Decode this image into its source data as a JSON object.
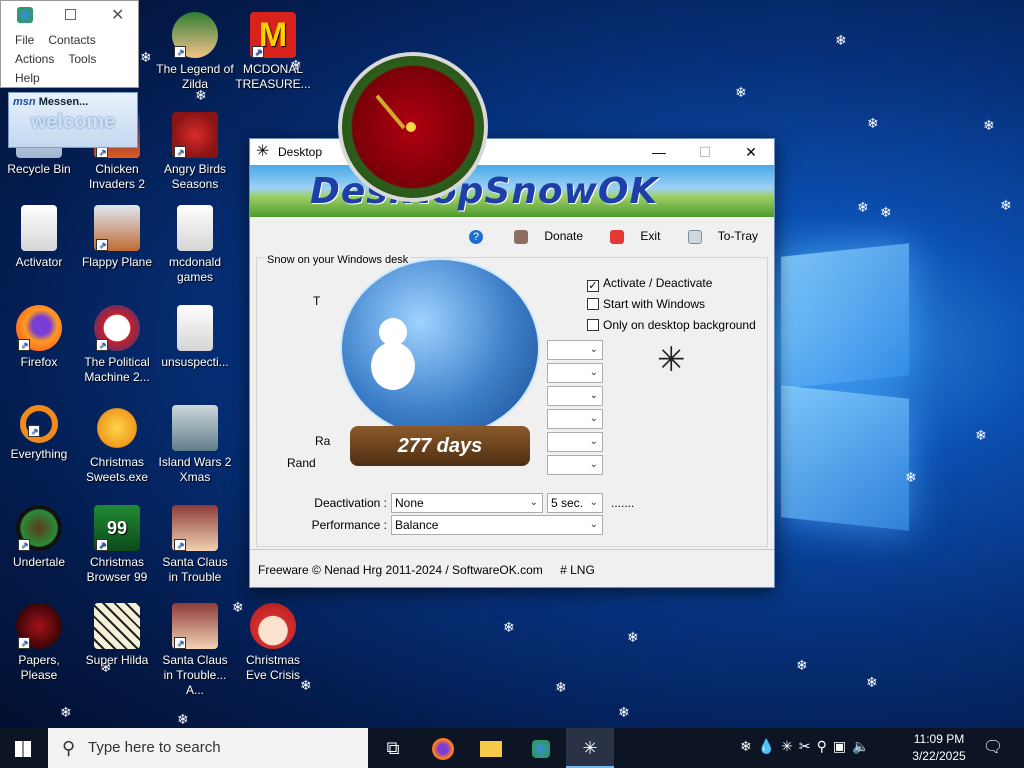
{
  "messenger": {
    "menu_row1": [
      "File",
      "Contacts"
    ],
    "menu_row2": [
      "Actions",
      "Tools"
    ],
    "menu_row3": [
      "Help"
    ],
    "msn_label": "Messen...",
    "welcome": "welcome",
    "logo_text": "msn"
  },
  "desktop_icons": [
    {
      "label": "Recycle Bin",
      "icon": "recycle-bin-icon"
    },
    {
      "label": "Activator",
      "icon": "folder-icon"
    },
    {
      "label": "Firefox",
      "icon": "firefox-icon"
    },
    {
      "label": "Everything",
      "icon": "everything-icon"
    },
    {
      "label": "Undertale",
      "icon": "undertale-icon"
    },
    {
      "label": "Papers, Please",
      "icon": "papers-please-icon"
    },
    {
      "label": "The Legend of Zilda",
      "icon": "game-icon"
    },
    {
      "label": "Chicken Invaders 2",
      "icon": "game-icon"
    },
    {
      "label": "Flappy Plane",
      "icon": "game-icon"
    },
    {
      "label": "The Political Machine 2...",
      "icon": "game-icon"
    },
    {
      "label": "Christmas Sweets.exe",
      "icon": "game-icon"
    },
    {
      "label": "Christmas Browser 99",
      "icon": "game-icon"
    },
    {
      "label": "Super Hilda",
      "icon": "game-icon"
    },
    {
      "label": "MCDONAL TREASURE...",
      "icon": "mcdonalds-icon"
    },
    {
      "label": "Angry Birds Seasons",
      "icon": "game-icon"
    },
    {
      "label": "mcdonald games",
      "icon": "folder-icon"
    },
    {
      "label": "unsuspecti...",
      "icon": "folder-icon"
    },
    {
      "label": "Island Wars 2 Xmas",
      "icon": "game-icon"
    },
    {
      "label": "Santa Claus in Trouble",
      "icon": "game-icon"
    },
    {
      "label": "Santa Claus in Trouble... A...",
      "icon": "game-icon"
    },
    {
      "label": "Christmas Eve Crisis",
      "icon": "game-icon"
    }
  ],
  "app": {
    "title": "Desktop",
    "banner_text": "DesktopSnowOK",
    "toolbar": {
      "help": "?",
      "donate": "Donate",
      "exit": "Exit",
      "tray": "To-Tray"
    },
    "group_label": "Snow on your Windows desk",
    "checkboxes": [
      {
        "label": "Activate / Deactivate",
        "checked": true
      },
      {
        "label": "Start with Windows",
        "checked": false
      },
      {
        "label": "Only on desktop background",
        "checked": false
      }
    ],
    "partial_labels": {
      "t": "T",
      "ra": "Ra",
      "rand": "Rand"
    },
    "deactivation_label": "Deactivation :",
    "deactivation_value": "None",
    "deactivation_time": "5 sec.",
    "dots": ".......",
    "performance_label": "Performance :",
    "performance_value": "Balance",
    "footer": "Freeware © Nenad Hrg 2011-2024 / SoftwareOK.com",
    "lng": "# LNG"
  },
  "globe": {
    "days_text": "277 days"
  },
  "taskbar": {
    "search_placeholder": "Type here to search",
    "time": "11:09 PM",
    "date": "3/22/2025"
  },
  "colors": {
    "accent": "#0b4fb0",
    "taskbar": "#0d1525"
  }
}
